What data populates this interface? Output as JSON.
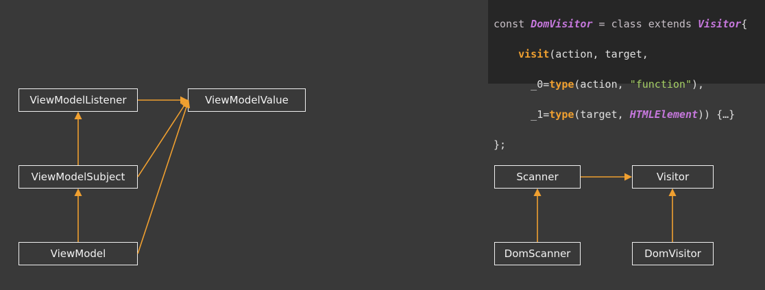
{
  "left_diagram": {
    "view_model_listener": "ViewModelListener",
    "view_model_value": "ViewModelValue",
    "view_model_subject": "ViewModelSubject",
    "view_model": "ViewModel"
  },
  "right_diagram": {
    "scanner": "Scanner",
    "visitor": "Visitor",
    "dom_scanner": "DomScanner",
    "dom_visitor": "DomVisitor"
  },
  "code": {
    "l1_const": "const ",
    "l1_name": "DomVisitor",
    "l1_mid": " = class extends ",
    "l1_base": "Visitor",
    "l1_brace": "{",
    "l2_indent": "    ",
    "l2_method": "visit",
    "l2_rest": "(action, target,",
    "l3_indent": "      _0=",
    "l3_type": "type",
    "l3_open": "(action, ",
    "l3_str": "\"function\"",
    "l3_close": "),",
    "l4_indent": "      _1=",
    "l4_type": "type",
    "l4_open": "(target, ",
    "l4_cls": "HTMLElement",
    "l4_close": ")) {…}",
    "l5": "};"
  },
  "colors": {
    "background": "#393939",
    "arrow": "#f0a030",
    "box_border": "#f2f2f2",
    "code_bg": "#262626"
  }
}
